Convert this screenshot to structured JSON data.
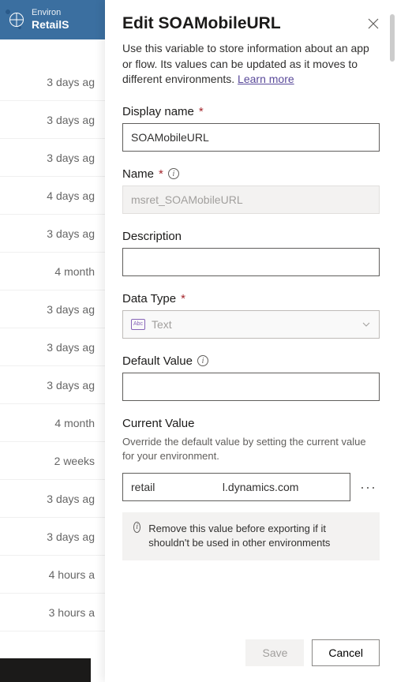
{
  "header": {
    "env_label": "Environ",
    "env_name": "RetailS"
  },
  "bg_rows": [
    "3 days ag",
    "3 days ag",
    "3 days ag",
    "4 days ag",
    "3 days ag",
    "4 month",
    "3 days ag",
    "3 days ag",
    "3 days ag",
    "4 month",
    "2 weeks",
    "3 days ag",
    "3 days ag",
    "4 hours a",
    "3 hours a"
  ],
  "panel": {
    "title": "Edit SOAMobileURL",
    "helper": "Use this variable to store information about an app or flow. Its values can be updated as it moves to different environments. ",
    "learn_more": "Learn more",
    "fields": {
      "display_name": {
        "label": "Display name",
        "value": "SOAMobileURL"
      },
      "name": {
        "label": "Name",
        "value": "msret_SOAMobileURL"
      },
      "description": {
        "label": "Description",
        "value": ""
      },
      "data_type": {
        "label": "Data Type",
        "value": "Text",
        "badge": "Abc"
      },
      "default_value": {
        "label": "Default Value",
        "value": ""
      },
      "current_value": {
        "label": "Current Value",
        "desc": "Override the default value by setting the current value for your environment.",
        "value": "retail                      l.dynamics.com"
      }
    },
    "info_banner": "Remove this value before exporting if it shouldn't be used in other environments",
    "buttons": {
      "save": "Save",
      "cancel": "Cancel"
    }
  }
}
